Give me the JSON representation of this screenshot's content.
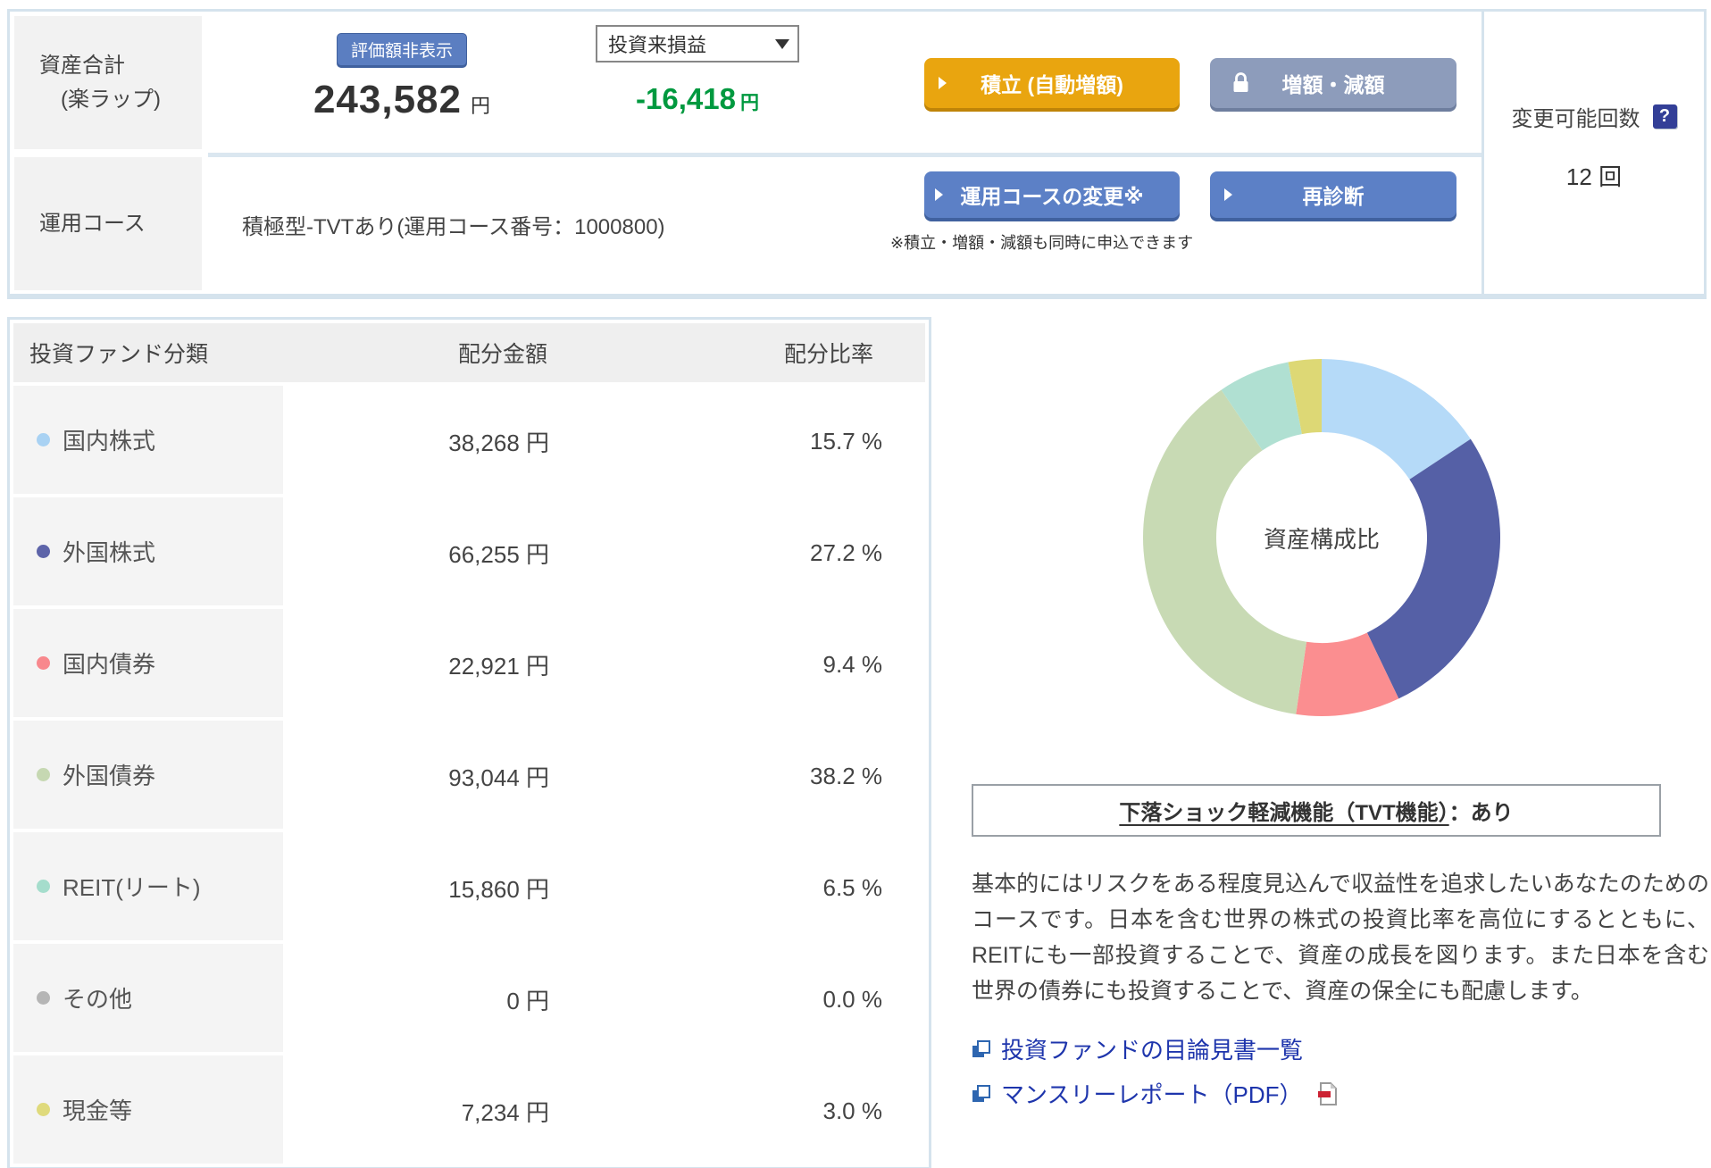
{
  "summary": {
    "asset_label_line1": "資産合計",
    "asset_label_line2": "(楽ラップ)",
    "hide_value_button": "評価額非表示",
    "total_amount": "243,582",
    "total_unit": "円",
    "pl_dropdown_value": "投資来損益",
    "pl_amount": "-16,418",
    "pl_unit": "円",
    "pl_color": "#00993f",
    "tsumitate_button": "積立 (自動増額)",
    "zougaku_button": "増額・減額",
    "course_label": "運用コース",
    "course_value": "積極型-TVTあり(運用コース番号：1000800)",
    "course_change_button": "運用コースの変更※",
    "rediagnose_button": "再診断",
    "note": "※積立・増額・減額も同時に申込できます",
    "change_count_label": "変更可能回数",
    "change_count_value": "12 回",
    "help_icon_glyph": "?"
  },
  "allocation": {
    "headers": [
      "投資ファンド分類",
      "配分金額",
      "配分比率"
    ],
    "rows": [
      {
        "label": "国内株式",
        "color": "#a9d2f3",
        "amount": "38,268 円",
        "ratio": "15.7 %"
      },
      {
        "label": "外国株式",
        "color": "#5d64a9",
        "amount": "66,255 円",
        "ratio": "27.2 %"
      },
      {
        "label": "国内債券",
        "color": "#f8888d",
        "amount": "22,921 円",
        "ratio": "9.4 %"
      },
      {
        "label": "外国債券",
        "color": "#c6d8b2",
        "amount": "93,044 円",
        "ratio": "38.2 %"
      },
      {
        "label": "REIT(リート)",
        "color": "#a5ddcc",
        "amount": "15,860 円",
        "ratio": "6.5 %"
      },
      {
        "label": "その他",
        "color": "#b5b5b5",
        "amount": "0 円",
        "ratio": "0.0 %"
      },
      {
        "label": "現金等",
        "color": "#dfda7c",
        "amount": "7,234 円",
        "ratio": "3.0 %"
      }
    ]
  },
  "chart_data": {
    "type": "pie",
    "donut": true,
    "title": "資産構成比",
    "categories": [
      "国内株式",
      "外国株式",
      "国内債券",
      "外国債券",
      "REIT(リート)",
      "その他",
      "現金等"
    ],
    "values": [
      15.7,
      27.2,
      9.4,
      38.2,
      6.5,
      0.0,
      3.0
    ],
    "colors": [
      "#b5daf8",
      "#5560a6",
      "#fb8e90",
      "#c8dab4",
      "#b0e0d2",
      "#b5b5b5",
      "#ddd875"
    ],
    "legend_position": "none"
  },
  "tvt": {
    "title": "下落ショック軽減機能（TVT機能）",
    "suffix": "：あり"
  },
  "description": "基本的にはリスクをある程度見込んで収益性を追求したいあなたのためのコースです。日本を含む世界の株式の投資比率を高位にするとともに、REITにも一部投資することで、資産の成長を図ります。また日本を含む世界の債券にも投資することで、資産の保全にも配慮します。",
  "links": {
    "prospectus": "投資ファンドの目論見書一覧",
    "monthly_report": "マンスリーレポート（PDF）"
  }
}
